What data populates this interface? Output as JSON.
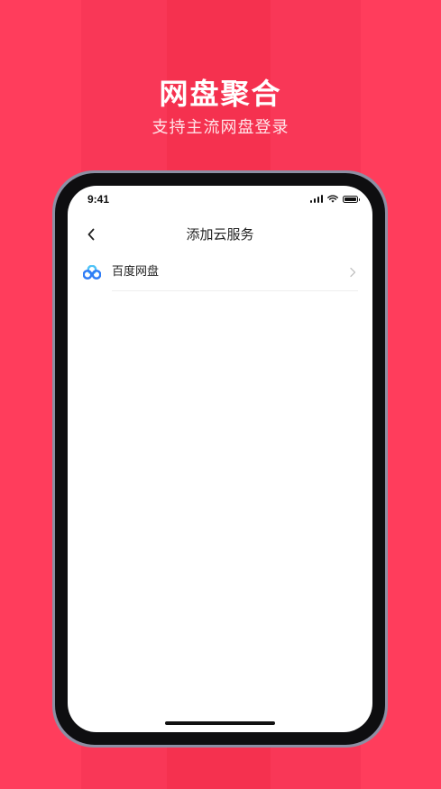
{
  "hero": {
    "title": "网盘聚合",
    "subtitle": "支持主流网盘登录"
  },
  "status_bar": {
    "time": "9:41",
    "icons": [
      "signal-icon",
      "wifi-icon",
      "battery-icon"
    ]
  },
  "nav": {
    "back_icon": "chevron-left-icon",
    "title": "添加云服务"
  },
  "services": [
    {
      "label": "百度网盘",
      "icon": "baidu-netdisk-icon",
      "chevron": "chevron-right-icon"
    }
  ],
  "colors": {
    "background": "#f5314f",
    "accent_blue": "#2f7cf6",
    "accent_cyan": "#4fc3f7"
  }
}
